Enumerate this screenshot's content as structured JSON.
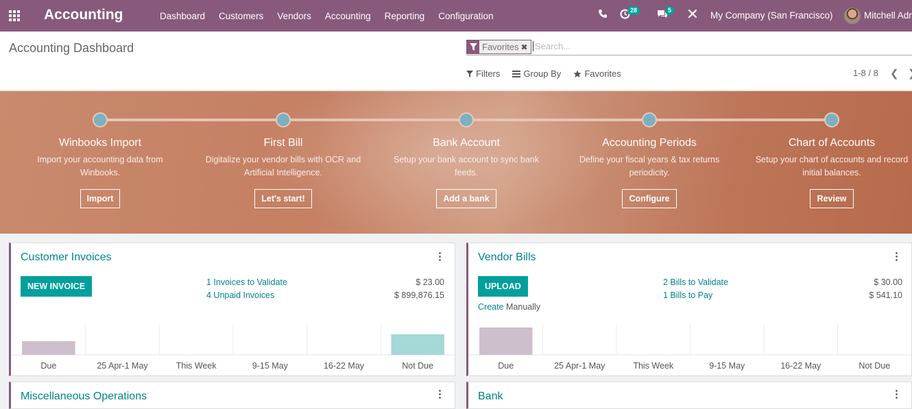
{
  "navbar": {
    "brand": "Accounting",
    "menu": [
      "Dashboard",
      "Customers",
      "Vendors",
      "Accounting",
      "Reporting",
      "Configuration"
    ],
    "activity_count": "28",
    "messages_count": "5",
    "company": "My Company (San Francisco)",
    "user": "Mitchell Admin"
  },
  "control": {
    "title": "Accounting Dashboard",
    "facet": "Favorites",
    "search_placeholder": "Search...",
    "filters": "Filters",
    "group_by": "Group By",
    "favorites": "Favorites",
    "pager": "1-8 / 8"
  },
  "onboarding": {
    "steps": [
      {
        "title": "Winbooks Import",
        "desc": "Import your accounting data from Winbooks.",
        "button": "Import"
      },
      {
        "title": "First Bill",
        "desc": "Digitalize your vendor bills with OCR and Artificial Intelligence.",
        "button": "Let's start!"
      },
      {
        "title": "Bank Account",
        "desc": "Setup your bank account to sync bank feeds.",
        "button": "Add a bank"
      },
      {
        "title": "Accounting Periods",
        "desc": "Define your fiscal years & tax returns periodicity.",
        "button": "Configure"
      },
      {
        "title": "Chart of Accounts",
        "desc": "Setup your chart of accounts and record initial balances.",
        "button": "Review"
      }
    ]
  },
  "cards": {
    "customer_invoices": {
      "title": "Customer Invoices",
      "button": "NEW INVOICE",
      "stats": [
        {
          "label": "1 Invoices to Validate",
          "amount": "$ 23.00"
        },
        {
          "label": "4 Unpaid Invoices",
          "amount": "$ 899,876.15"
        }
      ]
    },
    "vendor_bills": {
      "title": "Vendor Bills",
      "button": "UPLOAD",
      "create_prefix": "Create",
      "create_suffix": "Manually",
      "stats": [
        {
          "label": "2 Bills to Validate",
          "amount": "$ 30.00"
        },
        {
          "label": "1 Bills to Pay",
          "amount": "$ 541.10"
        }
      ]
    },
    "peek_left": {
      "title": "Miscellaneous Operations"
    },
    "peek_right": {
      "title": "Bank"
    }
  },
  "chart_data": [
    {
      "type": "bar",
      "categories": [
        "Due",
        "25 Apr-1 May",
        "This Week",
        "9-15 May",
        "16-22 May",
        "Not Due"
      ],
      "values": [
        15.19,
        0,
        0,
        0,
        0,
        22.14
      ],
      "colors": [
        "#cdbfcb",
        "#cdbfcb",
        "#cdbfcb",
        "#cdbfcb",
        "#cdbfcb",
        "#a4d9d7"
      ]
    },
    {
      "type": "bar",
      "categories": [
        "Due",
        "25 Apr-1 May",
        "This Week",
        "9-15 May",
        "16-22 May",
        "Not Due"
      ],
      "values": [
        30.0,
        0,
        0,
        0,
        0,
        0
      ],
      "colors": [
        "#cdbfcb",
        "#cdbfcb",
        "#cdbfcb",
        "#cdbfcb",
        "#cdbfcb",
        "#a4d9d7"
      ]
    }
  ]
}
